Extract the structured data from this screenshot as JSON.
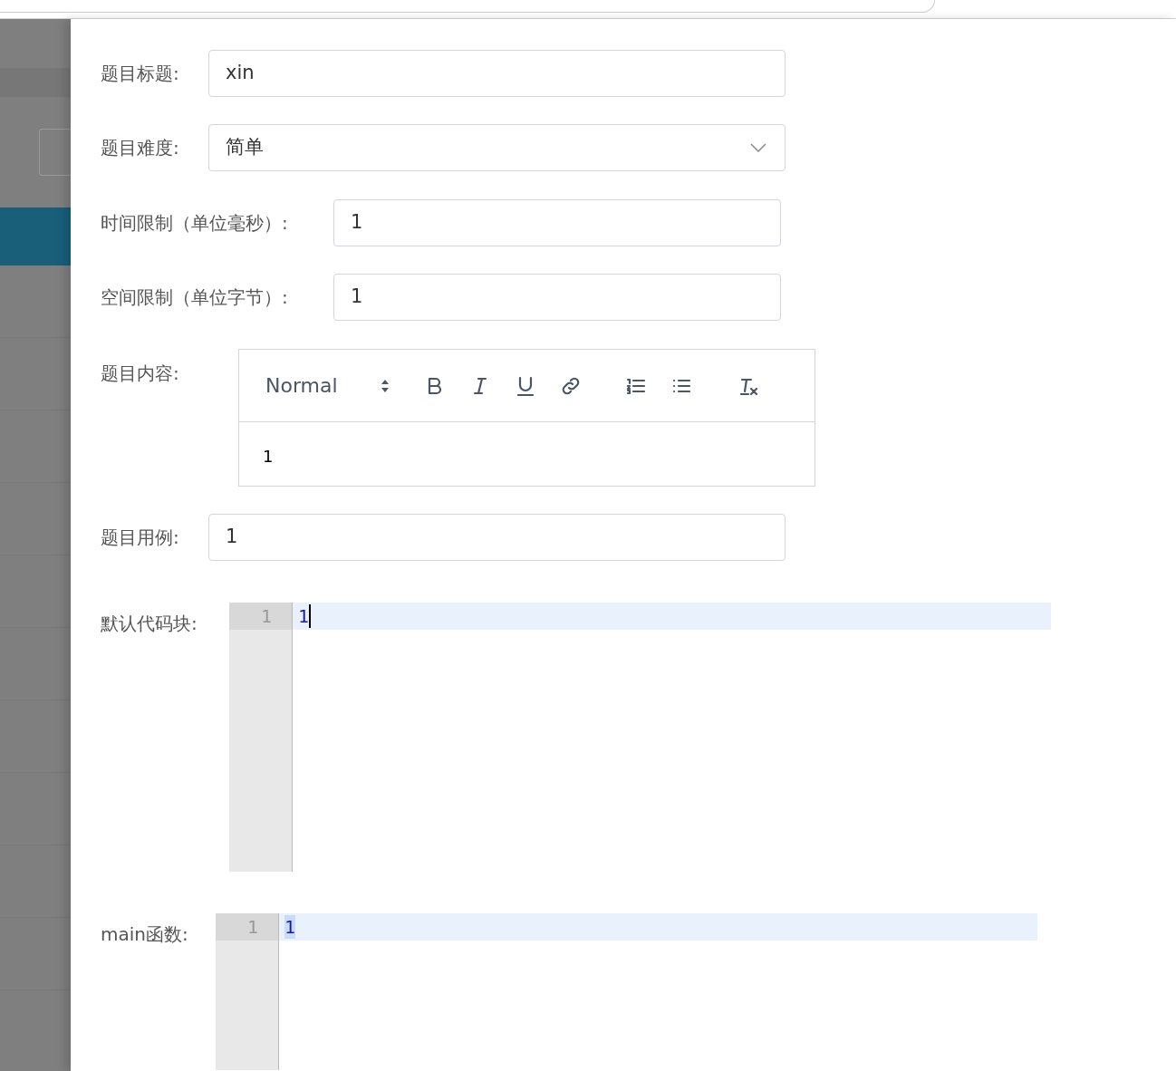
{
  "form": {
    "fields": [
      {
        "kind": "text",
        "label": "题目标题:",
        "value": "xin"
      },
      {
        "kind": "select",
        "label": "题目难度:",
        "value": "简单"
      },
      {
        "kind": "narrow",
        "label": "时间限制（单位毫秒）:",
        "value": "1"
      },
      {
        "kind": "narrow",
        "label": "空间限制（单位字节）:",
        "value": "1"
      },
      {
        "kind": "richtext",
        "label": "题目内容:",
        "format": "Normal",
        "value": "1"
      },
      {
        "kind": "text",
        "label": "题目用例:",
        "value": "1"
      },
      {
        "kind": "code",
        "label": "默认代码块:",
        "lines": [
          {
            "number": "1",
            "code": "1"
          }
        ],
        "focused": true
      },
      {
        "kind": "code",
        "label": "main函数:",
        "lines": [
          {
            "number": "1",
            "code": "1"
          }
        ],
        "focused": false
      }
    ]
  }
}
